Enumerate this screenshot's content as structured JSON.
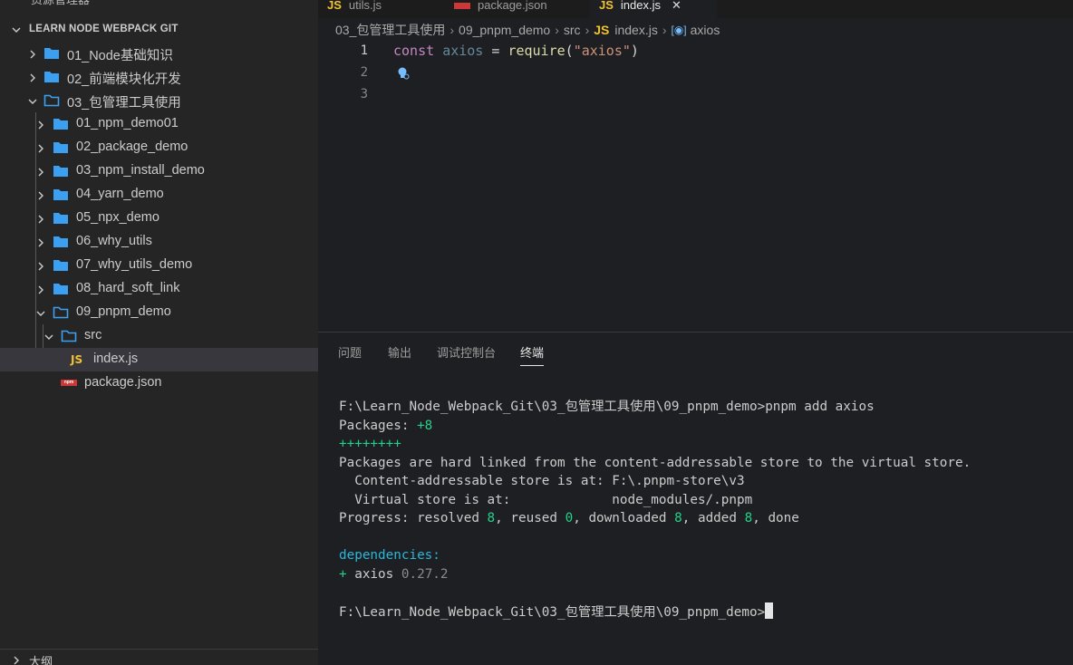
{
  "explorer": {
    "title": "资源管理器",
    "section": "LEARN NODE WEBPACK GIT",
    "outline_label": "大纲",
    "items": [
      {
        "label": "01_Node基础知识",
        "type": "folder",
        "expanded": false
      },
      {
        "label": "02_前端模块化开发",
        "type": "folder",
        "expanded": false
      },
      {
        "label": "03_包管理工具使用",
        "type": "folder",
        "expanded": true
      },
      {
        "label": "01_npm_demo01",
        "type": "folder",
        "expanded": false
      },
      {
        "label": "02_package_demo",
        "type": "folder",
        "expanded": false
      },
      {
        "label": "03_npm_install_demo",
        "type": "folder",
        "expanded": false
      },
      {
        "label": "04_yarn_demo",
        "type": "folder",
        "expanded": false
      },
      {
        "label": "05_npx_demo",
        "type": "folder",
        "expanded": false
      },
      {
        "label": "06_why_utils",
        "type": "folder",
        "expanded": false
      },
      {
        "label": "07_why_utils_demo",
        "type": "folder",
        "expanded": false
      },
      {
        "label": "08_hard_soft_link",
        "type": "folder",
        "expanded": false
      },
      {
        "label": "09_pnpm_demo",
        "type": "folder",
        "expanded": true
      },
      {
        "label": "src",
        "type": "folder",
        "expanded": true
      },
      {
        "label": "index.js",
        "type": "js",
        "selected": true
      },
      {
        "label": "package.json",
        "type": "npm"
      }
    ]
  },
  "tabs": [
    {
      "label": "utils.js",
      "icon": "JS"
    },
    {
      "label": "package.json",
      "icon": "npm"
    },
    {
      "label": "index.js",
      "icon": "JS",
      "active": true
    }
  ],
  "breadcrumb": {
    "parts": [
      "03_包管理工具使用",
      "09_pnpm_demo",
      "src"
    ],
    "file": "index.js",
    "file_icon": "JS",
    "symbol": "axios"
  },
  "editor": {
    "line_numbers": [
      "1",
      "2",
      "3"
    ],
    "code": {
      "kw": "const",
      "var": "axios",
      "op": "=",
      "fn": "require",
      "str": "\"axios\""
    }
  },
  "panel": {
    "tabs": [
      "问题",
      "输出",
      "调试控制台",
      "终端"
    ],
    "active_tab": "终端",
    "terminal": {
      "cmd_line": "F:\\Learn_Node_Webpack_Git\\03_包管理工具使用\\09_pnpm_demo>pnpm add axios",
      "packages_label": "Packages: ",
      "packages_value": "+8",
      "plus_line": "++++++++",
      "hardlink_line": "Packages are hard linked from the content-addressable store to the virtual store.",
      "store_line": "  Content-addressable store is at: F:\\.pnpm-store\\v3",
      "virtual_line": "  Virtual store is at:             node_modules/.pnpm",
      "progress_prefix": "Progress: resolved ",
      "resolved": "8",
      "reused_label": ", reused ",
      "reused": "0",
      "downloaded_label": ", downloaded ",
      "downloaded": "8",
      "added_label": ", added ",
      "added": "8",
      "done_label": ", done",
      "deps_label": "dependencies:",
      "dep_plus": "+ ",
      "dep_name": "axios ",
      "dep_version": "0.27.2",
      "prompt": "F:\\Learn_Node_Webpack_Git\\03_包管理工具使用\\09_pnpm_demo>"
    }
  }
}
